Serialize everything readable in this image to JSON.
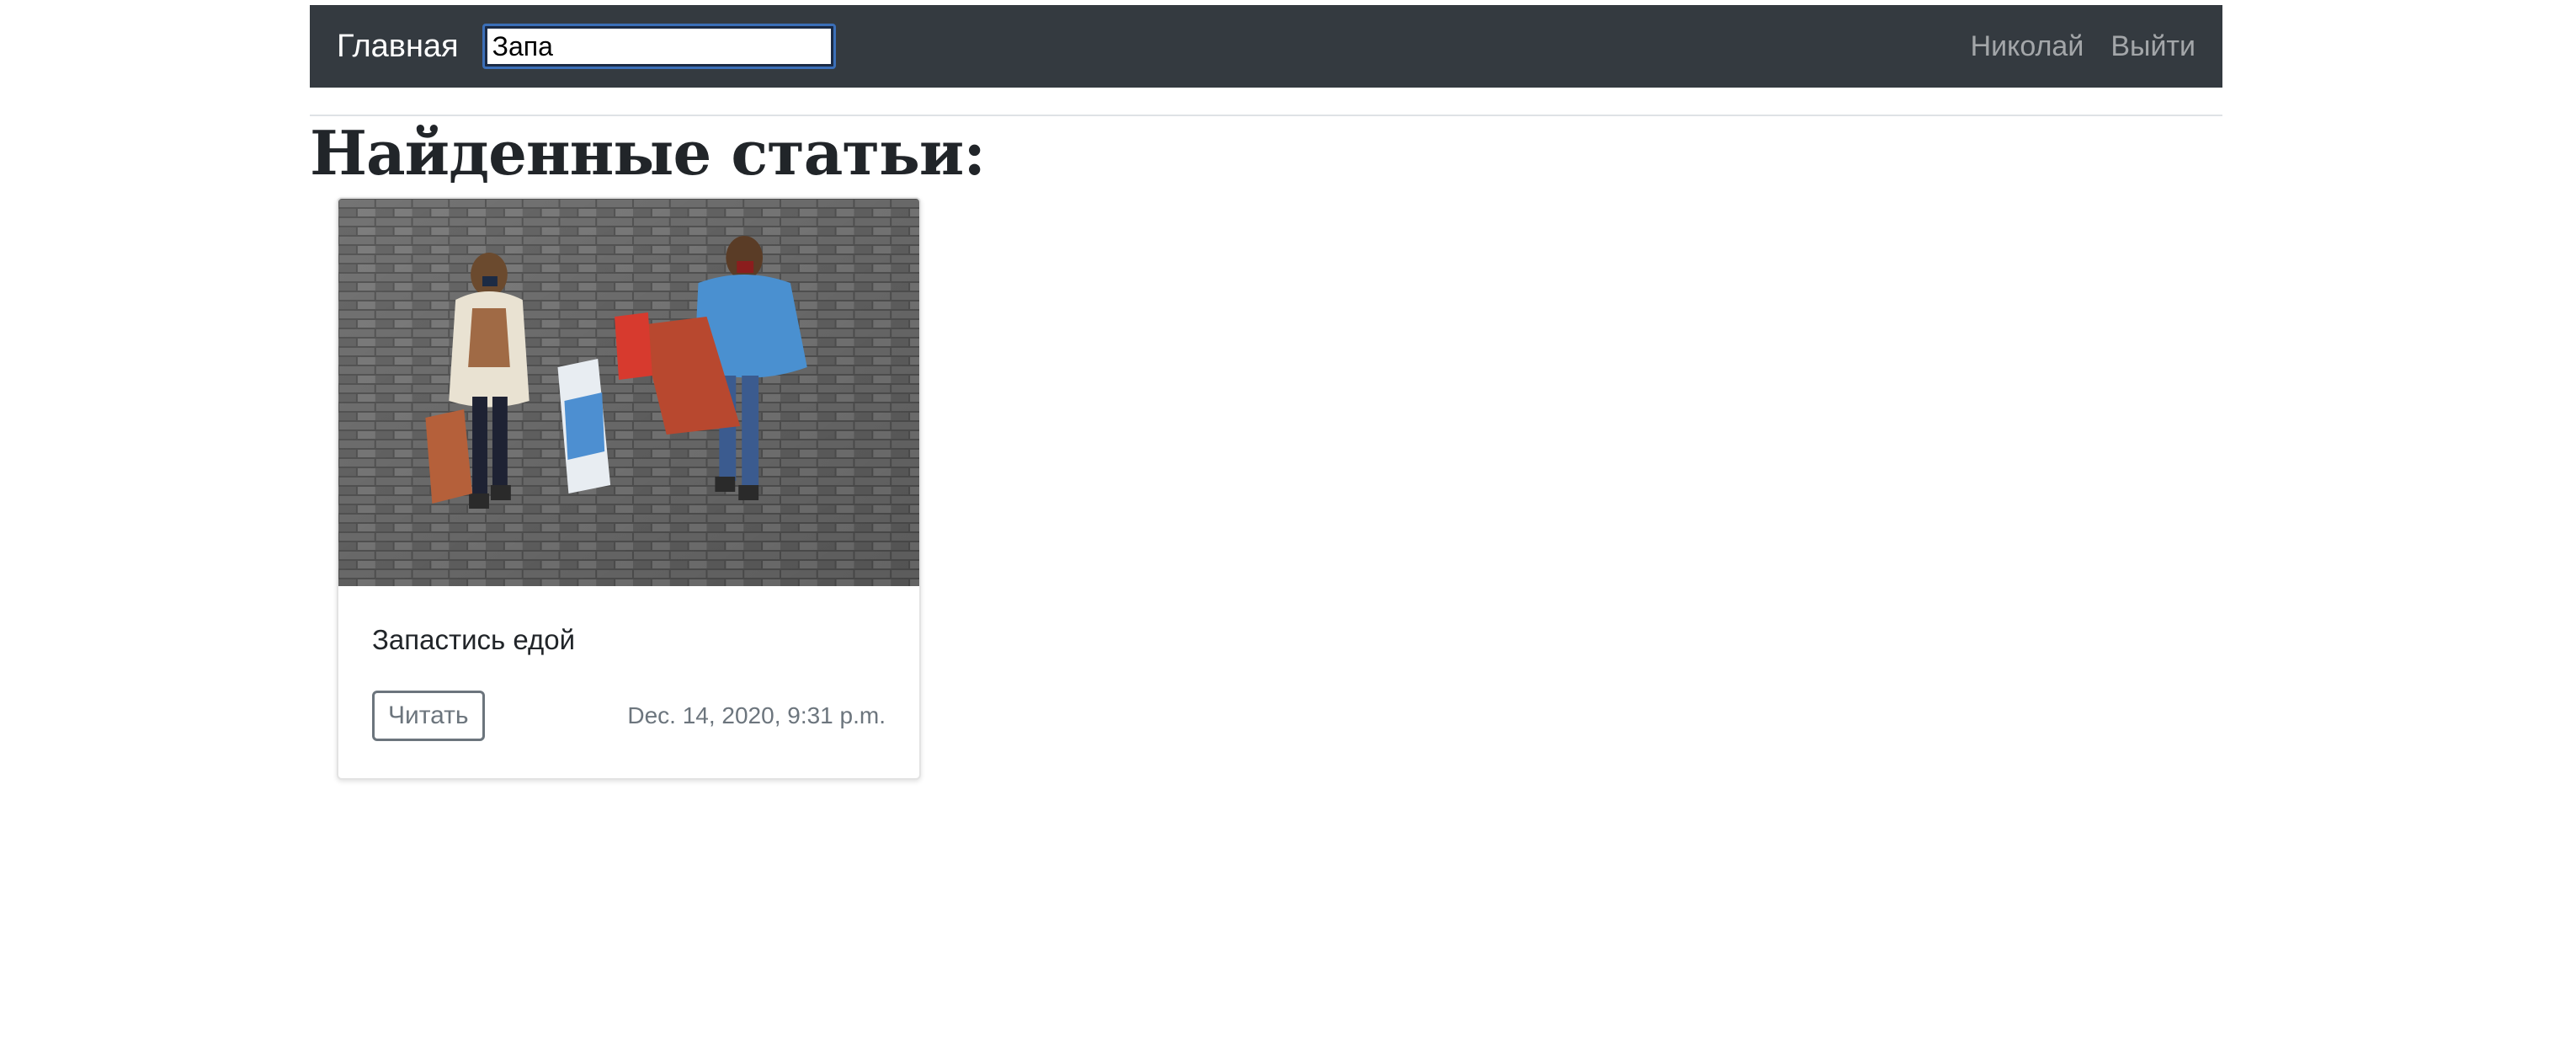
{
  "navbar": {
    "brand": "Главная",
    "search_value": "Запа",
    "user_link": "Николай",
    "logout_link": "Выйти"
  },
  "page": {
    "title": "Найденные статьи:"
  },
  "articles": [
    {
      "title": "Запастись едой",
      "read_label": "Читать",
      "date": "Dec. 14, 2020, 9:31 p.m."
    }
  ],
  "colors": {
    "navbar_bg": "#343a40",
    "nav_link": "#a0a3a6",
    "muted": "#6c757d"
  }
}
